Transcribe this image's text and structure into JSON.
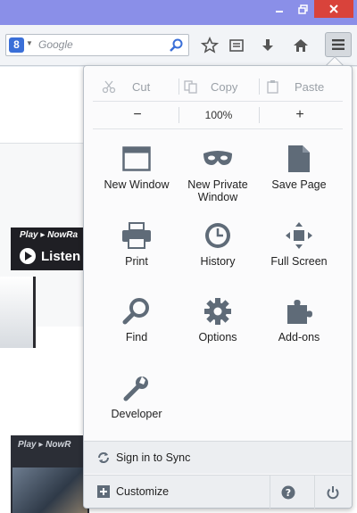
{
  "search": {
    "placeholder": "Google"
  },
  "edit": {
    "cut": "Cut",
    "copy": "Copy",
    "paste": "Paste"
  },
  "zoom": {
    "minus": "−",
    "value": "100%",
    "plus": "+"
  },
  "menu": {
    "items": [
      {
        "label": "New Window",
        "icon": "window-icon"
      },
      {
        "label": "New Private Window",
        "icon": "mask-icon"
      },
      {
        "label": "Save Page",
        "icon": "page-icon"
      },
      {
        "label": "Print",
        "icon": "printer-icon"
      },
      {
        "label": "History",
        "icon": "clock-icon"
      },
      {
        "label": "Full Screen",
        "icon": "fullscreen-icon"
      },
      {
        "label": "Find",
        "icon": "magnifier-icon"
      },
      {
        "label": "Options",
        "icon": "gear-icon"
      },
      {
        "label": "Add-ons",
        "icon": "puzzle-icon"
      },
      {
        "label": "Developer",
        "icon": "wrench-icon"
      }
    ]
  },
  "footer": {
    "sync": "Sign in to Sync",
    "customize": "Customize"
  },
  "background": {
    "player_title": "Play ▸ NowRa",
    "listen": "Listen",
    "player_title_2": "Play ▸ NowR"
  },
  "colors": {
    "titlebar": "#8a8fe8",
    "close": "#d9433b",
    "icon": "#5f6b78"
  }
}
